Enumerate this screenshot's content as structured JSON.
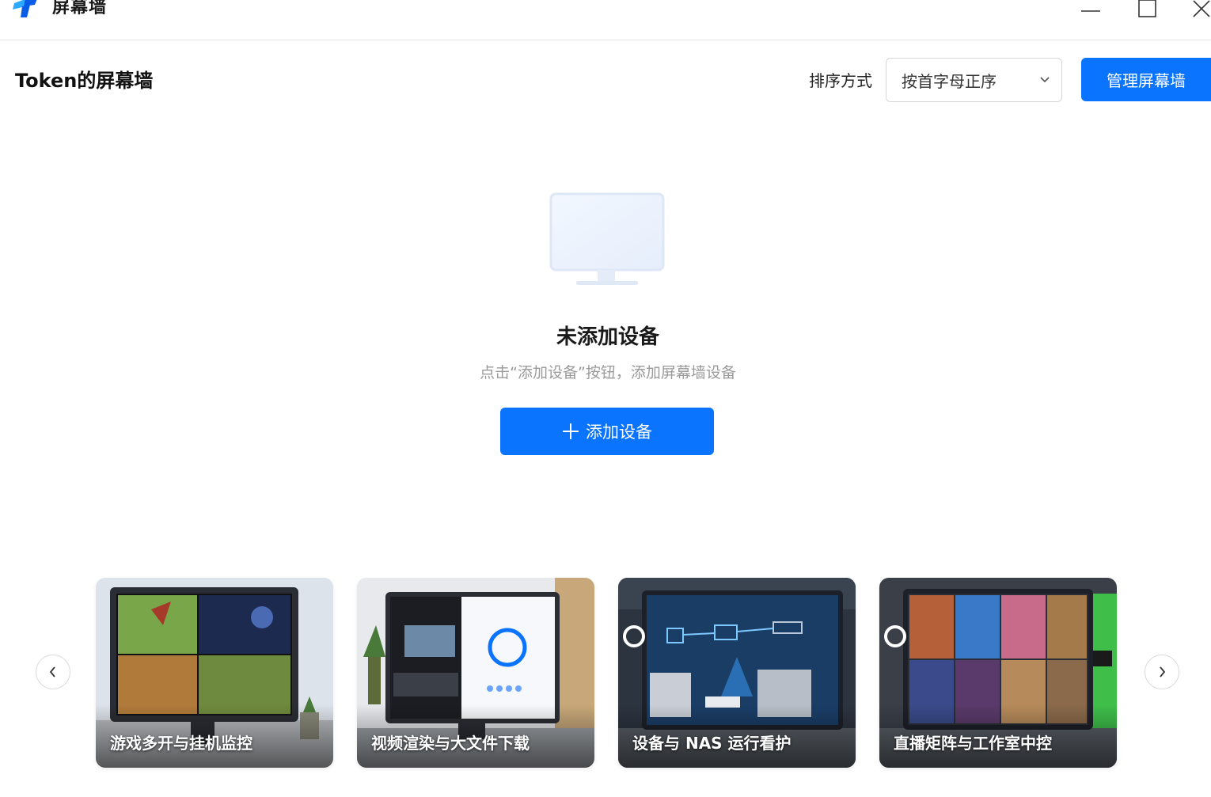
{
  "window": {
    "title": "屏幕墙",
    "colors": {
      "accent": "#0a74ff",
      "logo_dark": "#0a5ce6",
      "logo_light": "#2ea8ff"
    }
  },
  "header": {
    "title": "Token的屏幕墙",
    "sort_label": "排序方式",
    "sort_value": "按首字母正序",
    "manage_label": "管理屏幕墙"
  },
  "empty_state": {
    "title": "未添加设备",
    "subtitle": "点击“添加设备”按钮，添加屏幕墙设备",
    "add_label": "添加设备",
    "add_icon": "plus-icon"
  },
  "carousel": {
    "prev_icon": "chevron-left-icon",
    "next_icon": "chevron-right-icon",
    "cards": [
      {
        "caption": "游戏多开与挂机监控"
      },
      {
        "caption": "视频渲染与大文件下载"
      },
      {
        "caption": "设备与 NAS 运行看护"
      },
      {
        "caption": "直播矩阵与工作室中控"
      }
    ]
  }
}
